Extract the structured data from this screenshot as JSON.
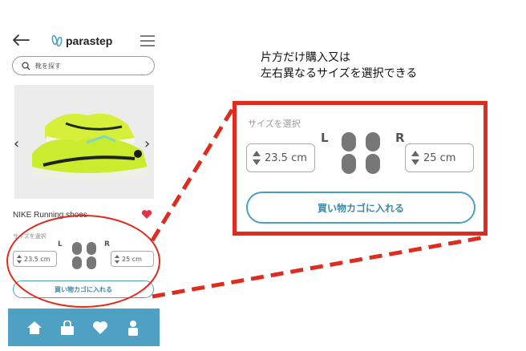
{
  "app": {
    "logo_text": "parastep",
    "search_placeholder": "靴を探す"
  },
  "product": {
    "name": "NIKE Running shoes",
    "image_alt": "neon running shoe"
  },
  "size_selector": {
    "label": "サイズを選択",
    "left_marker": "L",
    "right_marker": "R",
    "left_size": "23.5 cm",
    "right_size": "25 cm"
  },
  "cart_button_label": "買い物カゴに入れる",
  "tabbar": {
    "icons": [
      "home-icon",
      "bag-icon",
      "heart-icon",
      "user-icon"
    ]
  },
  "annotation": {
    "line1": "片方だけ購入又は",
    "line2": "左右異なるサイズを選択できる"
  },
  "colors": {
    "accent": "#4fa1c3",
    "callout_red": "#e02b1f",
    "favorite": "#e0334a"
  }
}
